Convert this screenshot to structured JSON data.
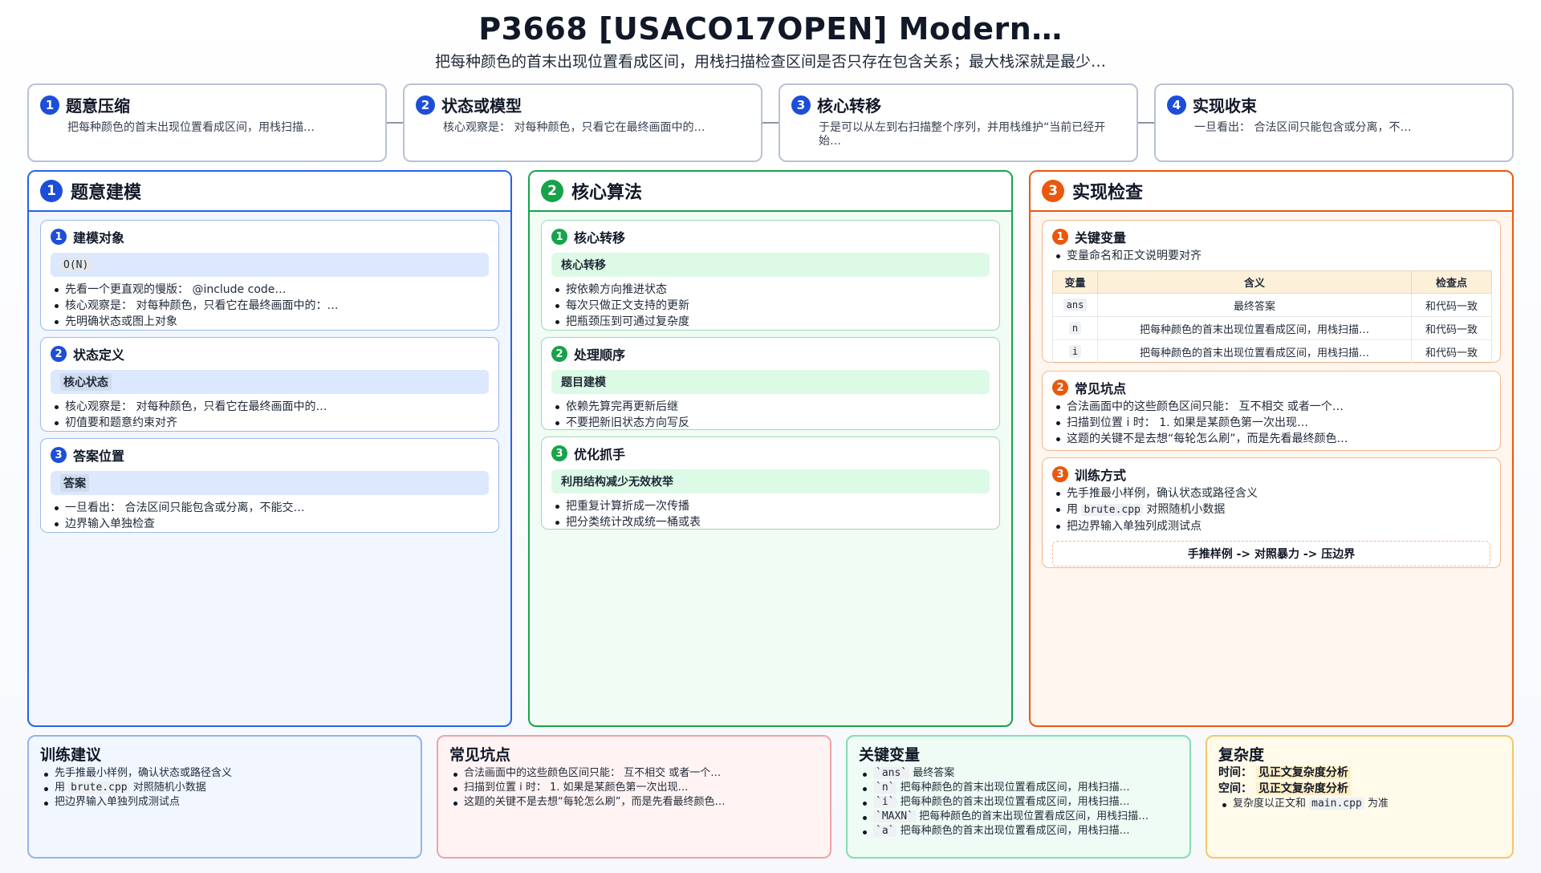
{
  "header": {
    "title": "P3668 [USACO17OPEN] Modern…",
    "subtitle": "把每种颜色的首末出现位置看成区间，用栈扫描检查区间是否只存在包含关系；最大栈深就是最少…"
  },
  "steps": [
    {
      "num": "1",
      "title": "题意压缩",
      "desc": "把每种颜色的首末出现位置看成区间，用栈扫描…"
    },
    {
      "num": "2",
      "title": "状态或模型",
      "desc": "核心观察是： 对每种颜色，只看它在最终画面中的…"
    },
    {
      "num": "3",
      "title": "核心转移",
      "desc": "于是可以从左到右扫描整个序列，并用栈维护“当前已经开始…"
    },
    {
      "num": "4",
      "title": "实现收束",
      "desc": "一旦看出： 合法区间只能包含或分离，不…"
    }
  ],
  "columns": {
    "c1": {
      "num": "1",
      "title": "题意建模",
      "cards": [
        {
          "num": "1",
          "title": "建模对象",
          "pill": "O(N)",
          "items": [
            "先看一个更直观的慢版： @include code…",
            "核心观察是： 对每种颜色，只看它在最终画面中的：…",
            "先明确状态或图上对象"
          ]
        },
        {
          "num": "2",
          "title": "状态定义",
          "pill": "核心状态",
          "items": [
            "核心观察是： 对每种颜色，只看它在最终画面中的…",
            "初值要和题意约束对齐"
          ]
        },
        {
          "num": "3",
          "title": "答案位置",
          "pill": "答案",
          "items": [
            "一旦看出： 合法区间只能包含或分离，不能交…",
            "边界输入单独检查"
          ]
        }
      ]
    },
    "c2": {
      "num": "2",
      "title": "核心算法",
      "cards": [
        {
          "num": "1",
          "title": "核心转移",
          "pill": "核心转移",
          "items": [
            "按依赖方向推进状态",
            "每次只做正文支持的更新",
            "把瓶颈压到可通过复杂度"
          ]
        },
        {
          "num": "2",
          "title": "处理顺序",
          "pill": "题目建模",
          "items": [
            "依赖先算完再更新后继",
            "不要把新旧状态方向写反"
          ]
        },
        {
          "num": "3",
          "title": "优化抓手",
          "pill": "利用结构减少无效枚举",
          "items": [
            "把重复计算折成一次传播",
            "把分类统计改成统一桶或表"
          ]
        }
      ]
    },
    "c3": {
      "num": "3",
      "title": "实现检查",
      "vars_card": {
        "num": "1",
        "title": "关键变量",
        "note": "变量命名和正文说明要对齐",
        "headers": [
          "变量",
          "含义",
          "检查点"
        ],
        "rows": [
          [
            "ans",
            "最终答案",
            "和代码一致"
          ],
          [
            "n",
            "把每种颜色的首末出现位置看成区间，用栈扫描…",
            "和代码一致"
          ],
          [
            "i",
            "把每种颜色的首末出现位置看成区间，用栈扫描…",
            "和代码一致"
          ]
        ]
      },
      "pitfalls_card": {
        "num": "2",
        "title": "常见坑点",
        "items": [
          "合法画面中的这些颜色区间只能： 互不相交 或者一个…",
          "扫描到位置 i 时： 1. 如果是某颜色第一次出现…",
          "这题的关键不是去想“每轮怎么刷”，而是先看最终颜色…"
        ]
      },
      "train_card": {
        "num": "3",
        "title": "训练方式",
        "item1": "先手推最小样例，确认状态或路径含义",
        "item2_pre": "用",
        "item2_code": "brute.cpp",
        "item2_post": "对照随机小数据",
        "item3": "把边界输入单独列成测试点",
        "flow": "手推样例 -> 对照暴力 -> 压边界"
      }
    }
  },
  "bottom": {
    "training": {
      "title": "训练建议",
      "item1": "先手推最小样例，确认状态或路径含义",
      "item2_pre": "用",
      "item2_code": "brute.cpp",
      "item2_post": "对照随机小数据",
      "item3": "把边界输入单独列成测试点"
    },
    "pitfalls": {
      "title": "常见坑点",
      "items": [
        "合法画面中的这些颜色区间只能： 互不相交 或者一个…",
        "扫描到位置 i 时： 1. 如果是某颜色第一次出现…",
        "这题的关键不是去想“每轮怎么刷”，而是先看最终颜色…"
      ]
    },
    "vars": {
      "title": "关键变量",
      "items": [
        {
          "code": "`ans`",
          "text": "最终答案"
        },
        {
          "code": "`n`",
          "text": "把每种颜色的首末出现位置看成区间，用栈扫描…"
        },
        {
          "code": "`i`",
          "text": "把每种颜色的首末出现位置看成区间，用栈扫描…"
        },
        {
          "code": "`MAXN`",
          "text": "把每种颜色的首末出现位置看成区间，用栈扫描…"
        },
        {
          "code": "`a`",
          "text": "把每种颜色的首末出现位置看成区间，用栈扫描…"
        }
      ]
    },
    "complexity": {
      "title": "复杂度",
      "time_label": "时间：",
      "time_value": "见正文复杂度分析",
      "space_label": "空间：",
      "space_value": "见正文复杂度分析",
      "note_pre": "复杂度以正文和",
      "note_code": "main.cpp",
      "note_post": "为准"
    }
  },
  "colors": {
    "blue": "#1d4ed8",
    "green": "#16a34a",
    "orange": "#ea580c",
    "red": "#f1a3a6",
    "yellow": "#f2c76a"
  }
}
